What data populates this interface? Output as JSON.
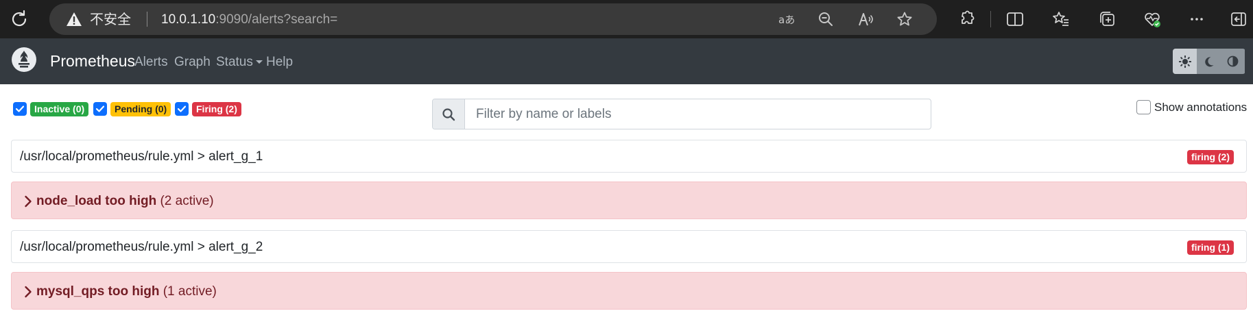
{
  "browser": {
    "security_label": "不安全",
    "url_host": "10.0.1.10",
    "url_rest": ":9090/alerts?search="
  },
  "navbar": {
    "brand": "Prometheus",
    "links": [
      {
        "label": "Alerts"
      },
      {
        "label": "Graph"
      },
      {
        "label": "Status"
      },
      {
        "label": "Help"
      }
    ]
  },
  "filters": {
    "inactive": {
      "label": "Inactive (0)",
      "checked": true
    },
    "pending": {
      "label": "Pending (0)",
      "checked": true
    },
    "firing": {
      "label": "Firing (2)",
      "checked": true
    },
    "search_placeholder": "Filter by name or labels",
    "search_value": "",
    "show_annotations_label": "Show annotations",
    "show_annotations_checked": false
  },
  "groups": [
    {
      "title": "/usr/local/prometheus/rule.yml > alert_g_1",
      "badge": "firing (2)",
      "alert": {
        "name": "node_load too high",
        "active": "(2 active)"
      }
    },
    {
      "title": "/usr/local/prometheus/rule.yml > alert_g_2",
      "badge": "firing (1)",
      "alert": {
        "name": "mysql_qps too high",
        "active": "(1 active)"
      }
    }
  ],
  "colors": {
    "navbar_bg": "#343a40",
    "inactive": "#28a745",
    "pending": "#ffc107",
    "firing": "#dc3545",
    "alert_row_bg": "#f8d7da",
    "checkbox": "#0d6efd"
  },
  "icons": {
    "reload": "reload-icon",
    "warning": "warning-icon",
    "search": "search-icon",
    "logo": "prometheus-logo-icon",
    "theme_light": "sun-icon",
    "theme_dark": "moon-icon",
    "theme_auto": "contrast-icon"
  }
}
